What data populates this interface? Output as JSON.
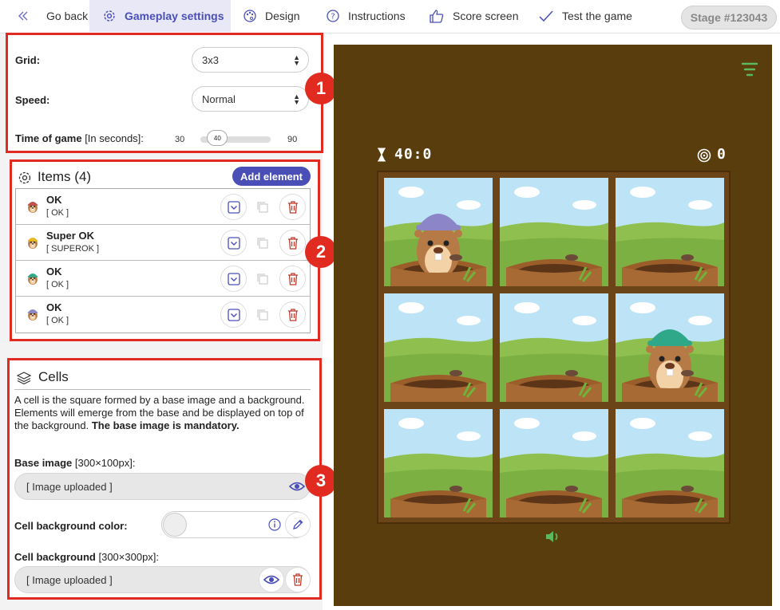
{
  "nav": {
    "back": "Go back",
    "gameplay": "Gameplay settings",
    "design": "Design",
    "instructions": "Instructions",
    "score": "Score screen",
    "test": "Test the game",
    "stage": "Stage #123043"
  },
  "settings": {
    "grid_label": "Grid:",
    "grid_value": "3x3",
    "speed_label": "Speed:",
    "speed_value": "Normal",
    "time_label": "Time of game",
    "time_unit": "[In seconds]:",
    "time_min": "30",
    "time_max": "90",
    "time_value": "40",
    "time_fraction": 0.1667
  },
  "items": {
    "title": "Items (4)",
    "add_label": "Add element",
    "list": [
      {
        "name": "OK",
        "code": "[ OK ]",
        "hat_color": "#c0524a"
      },
      {
        "name": "Super OK",
        "code": "[ SUPEROK ]",
        "hat_color": "#e8b820"
      },
      {
        "name": "OK",
        "code": "[ OK ]",
        "hat_color": "#2fa88a"
      },
      {
        "name": "OK",
        "code": "[ OK ]",
        "hat_color": "#8c86c8"
      }
    ]
  },
  "cells": {
    "title": "Cells",
    "description": "A cell is the square formed by a base image and a background. Elements will emerge from the base and be displayed on top of the background.",
    "description_bold": "The base image is mandatory.",
    "base_label": "Base image",
    "base_size": "[300×100px]:",
    "base_value": "[ Image uploaded ]",
    "color_label": "Cell background color:",
    "bg_label": "Cell background",
    "bg_size": "[300×300px]:",
    "bg_value": "[ Image uploaded ]"
  },
  "markers": [
    "1",
    "2",
    "3"
  ],
  "game": {
    "timer": "40:0",
    "score": "0",
    "moles": [
      {
        "cell": 0,
        "hat_color": "#8c86c8"
      },
      {
        "cell": 5,
        "hat_color": "#2fa88a"
      }
    ]
  },
  "colors": {
    "accent": "#4a4fb8",
    "marker": "#e12b20",
    "preview_bg": "#5a3d0d",
    "delete": "#c0392b"
  }
}
